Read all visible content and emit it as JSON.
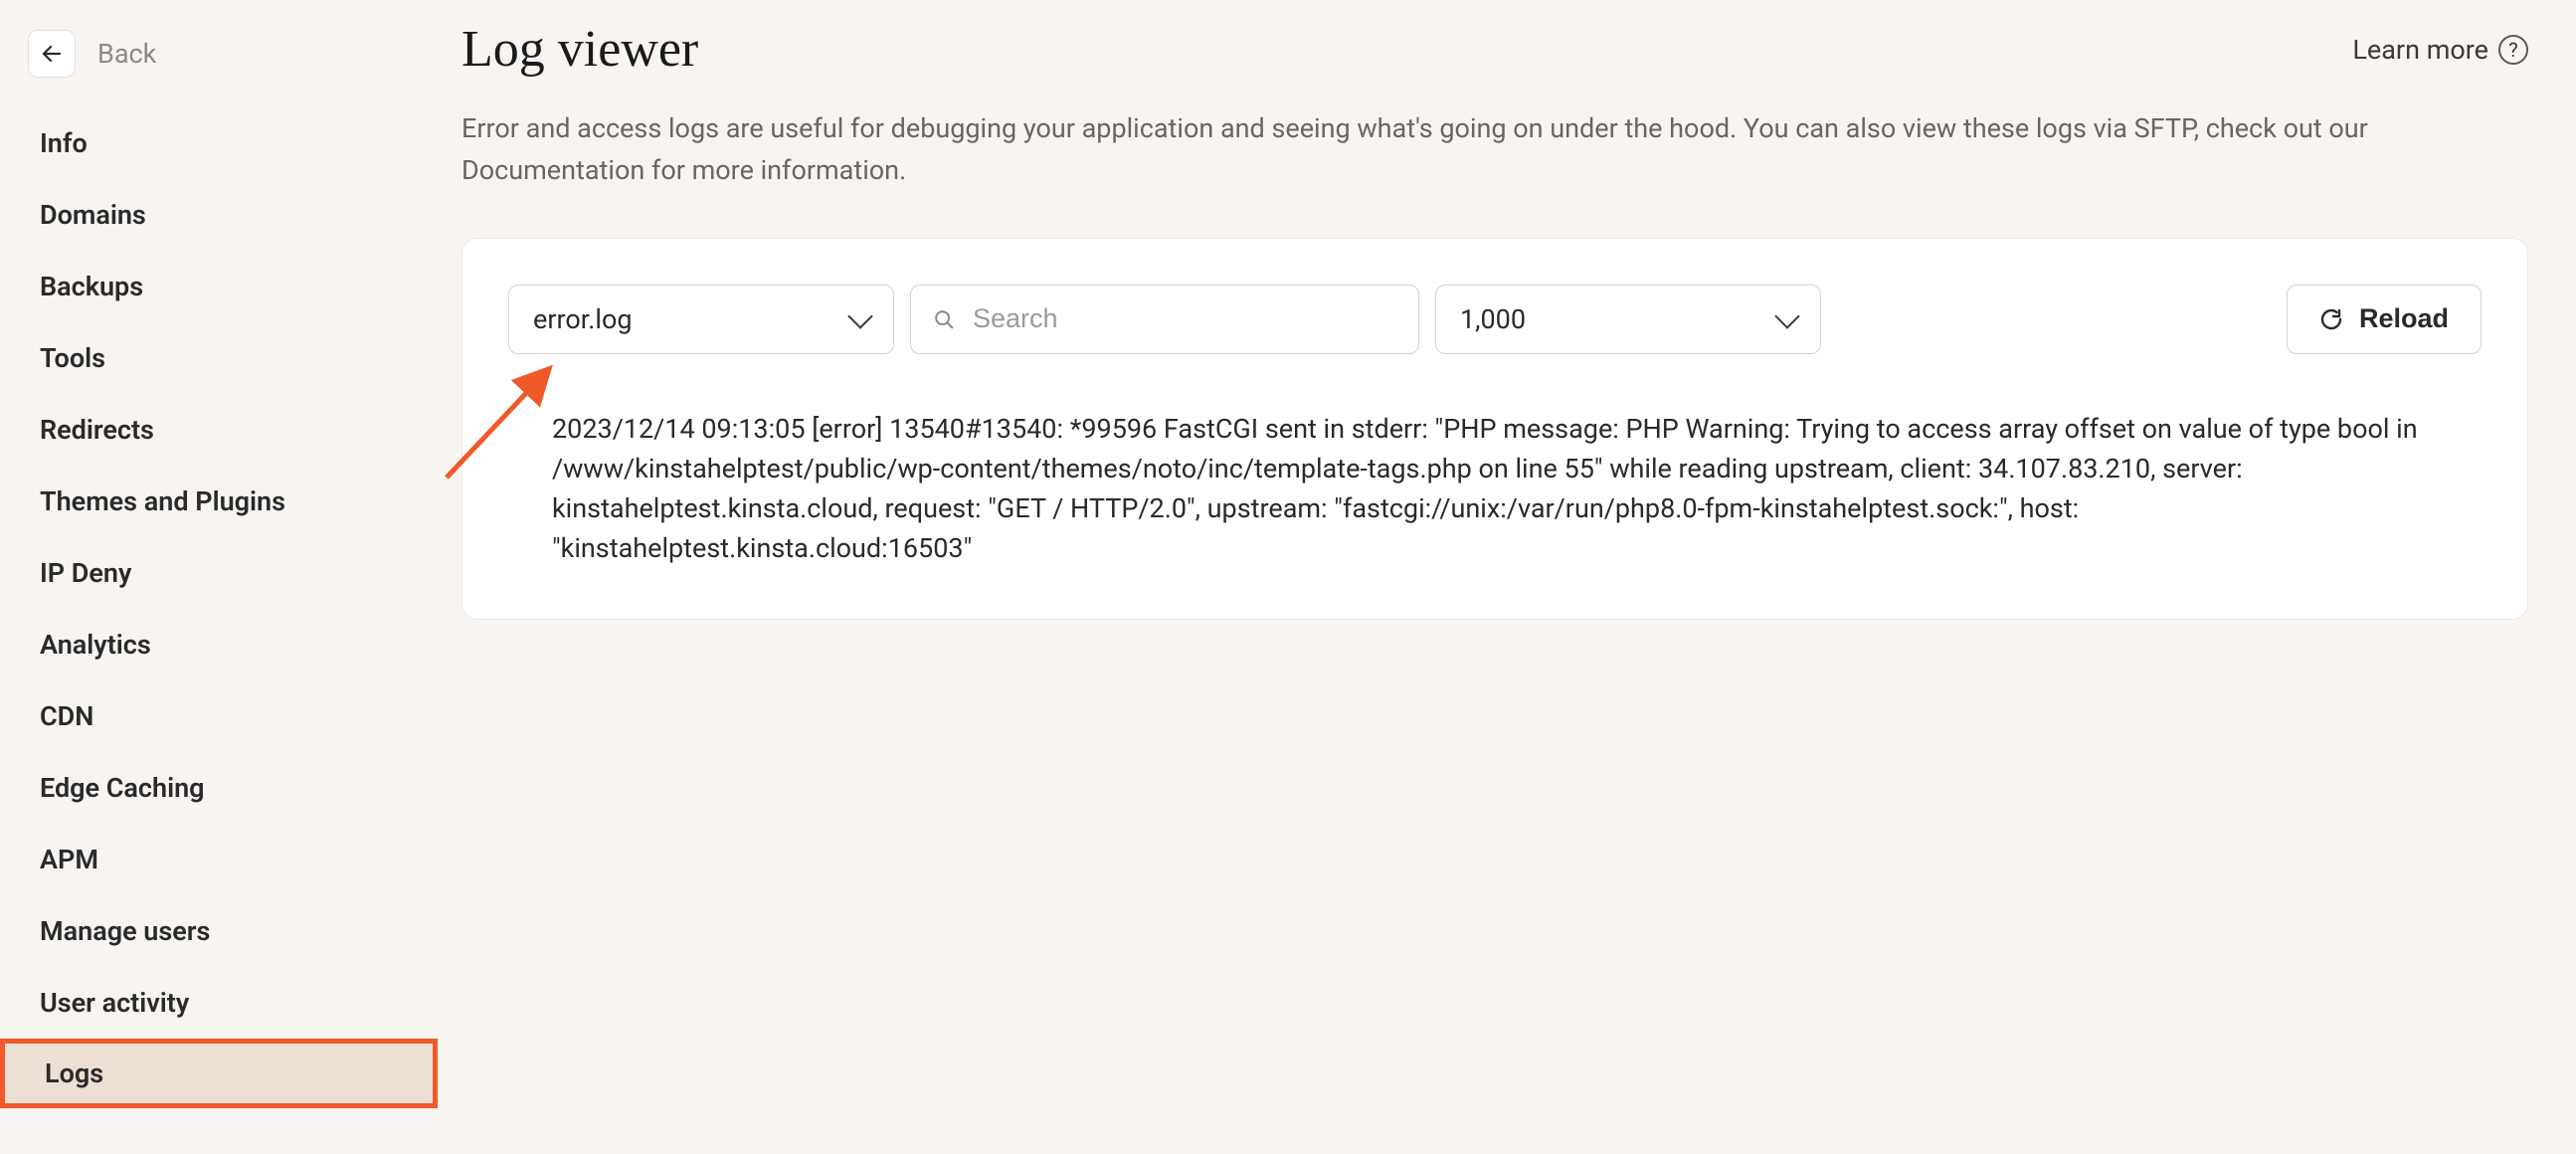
{
  "sidebar": {
    "back_label": "Back",
    "items": [
      {
        "label": "Info"
      },
      {
        "label": "Domains"
      },
      {
        "label": "Backups"
      },
      {
        "label": "Tools"
      },
      {
        "label": "Redirects"
      },
      {
        "label": "Themes and Plugins"
      },
      {
        "label": "IP Deny"
      },
      {
        "label": "Analytics"
      },
      {
        "label": "CDN"
      },
      {
        "label": "Edge Caching"
      },
      {
        "label": "APM"
      },
      {
        "label": "Manage users"
      },
      {
        "label": "User activity"
      },
      {
        "label": "Logs"
      }
    ],
    "active_index": 13
  },
  "header": {
    "title": "Log viewer",
    "learn_more": "Learn more"
  },
  "description": "Error and access logs are useful for debugging your application and seeing what's going on under the hood. You can also view these logs via SFTP, check out our Documentation for more information.",
  "controls": {
    "log_select": "error.log",
    "search_placeholder": "Search",
    "count_select": "1,000",
    "reload_label": "Reload"
  },
  "log_entries": [
    "2023/12/14 09:13:05 [error] 13540#13540: *99596 FastCGI sent in stderr: \"PHP message: PHP Warning: Trying to access array offset on value of type bool in /www/kinstahelptest/public/wp-content/themes/noto/inc/template-tags.php on line 55\" while reading upstream, client: 34.107.83.210, server: kinstahelptest.kinsta.cloud, request: \"GET / HTTP/2.0\", upstream: \"fastcgi://unix:/var/run/php8.0-fpm-kinstahelptest.sock:\", host: \"kinstahelptest.kinsta.cloud:16503\""
  ]
}
